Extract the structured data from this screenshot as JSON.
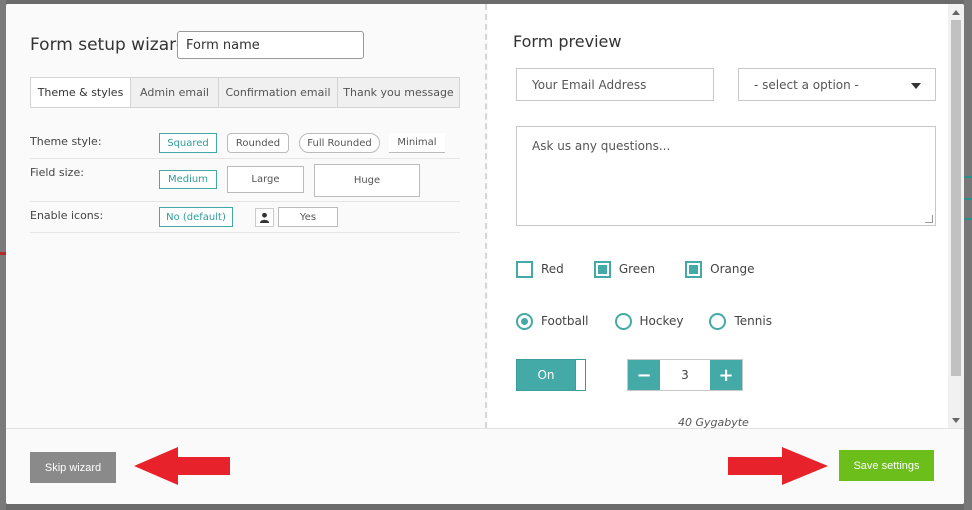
{
  "wizard": {
    "title": "Form setup wizard",
    "form_name_value": "Form name",
    "tabs": [
      {
        "label": "Theme & styles",
        "active": true
      },
      {
        "label": "Admin email",
        "active": false
      },
      {
        "label": "Confirmation email",
        "active": false
      },
      {
        "label": "Thank you message",
        "active": false
      }
    ],
    "settings": {
      "theme_style": {
        "label": "Theme style:",
        "options": [
          "Squared",
          "Rounded",
          "Full Rounded",
          "Minimal"
        ],
        "selected": "Squared"
      },
      "field_size": {
        "label": "Field size:",
        "options": [
          "Medium",
          "Large",
          "Huge"
        ],
        "selected": "Medium"
      },
      "enable_icons": {
        "label": "Enable icons:",
        "options": [
          "No (default)",
          "Yes"
        ],
        "selected": "No (default)",
        "icon": "user-icon"
      }
    }
  },
  "preview": {
    "title": "Form preview",
    "email_placeholder": "Your Email Address",
    "select_value": "- select a option -",
    "textarea_placeholder": "Ask us any questions...",
    "checkboxes": [
      {
        "label": "Red",
        "checked": false
      },
      {
        "label": "Green",
        "checked": true
      },
      {
        "label": "Orange",
        "checked": true
      }
    ],
    "radios": [
      {
        "label": "Football",
        "selected": true
      },
      {
        "label": "Hockey",
        "selected": false
      },
      {
        "label": "Tennis",
        "selected": false
      }
    ],
    "toggle_label": "On",
    "stepper": {
      "minus": "−",
      "value": "3",
      "plus": "+"
    },
    "slider_text": "40 Gygabyte"
  },
  "footer": {
    "skip_label": "Skip wizard",
    "save_label": "Save settings"
  },
  "colors": {
    "accent": "#44aaa8",
    "save": "#6cbf1a",
    "skip": "#8a8a8a",
    "arrow": "#e8222a"
  }
}
